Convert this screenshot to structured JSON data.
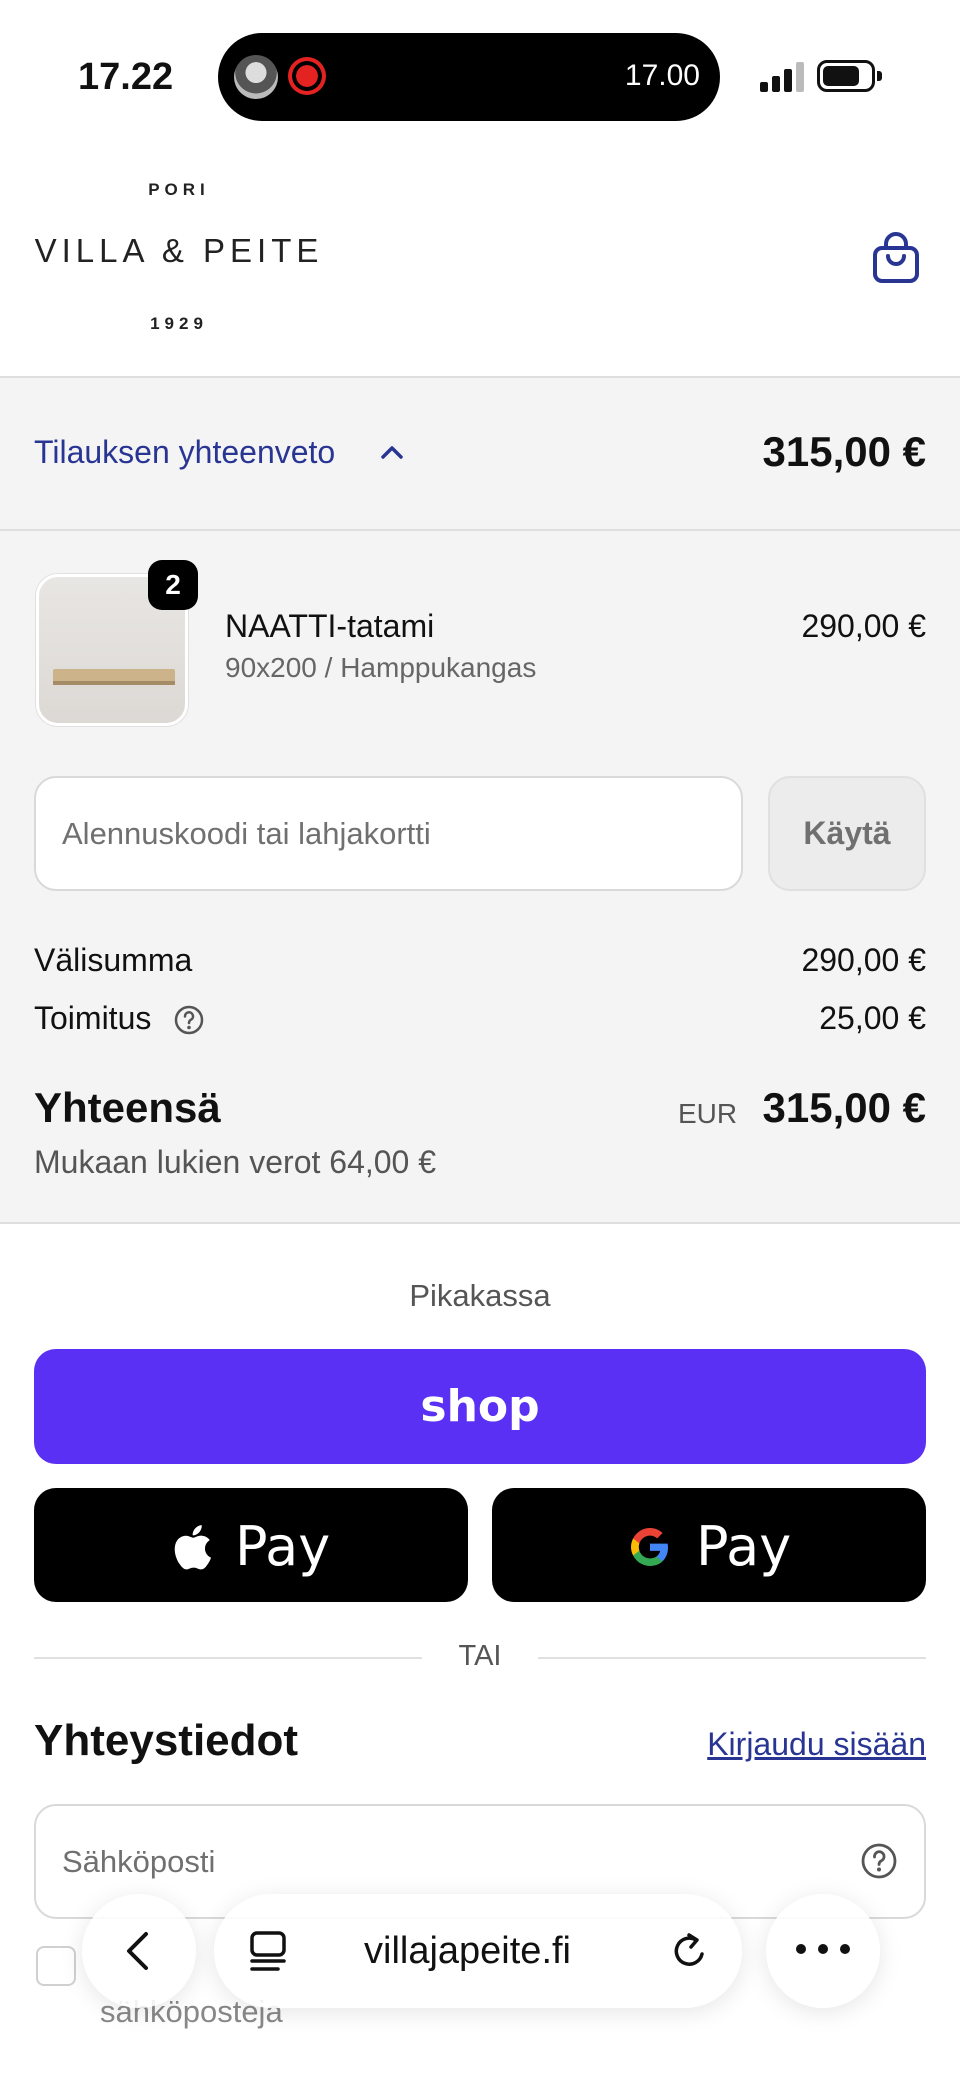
{
  "status_bar": {
    "time": "17.22",
    "live_activity_time": "17.00"
  },
  "brand": {
    "logo_top": "PORI",
    "logo_main": "VILLA & PEITE",
    "logo_bottom": "1929"
  },
  "summary": {
    "toggle_label": "Tilauksen yhteenveto",
    "total": "315,00 €",
    "item": {
      "quantity": "2",
      "name": "NAATTI-tatami",
      "variant": "90x200 / Hamppukangas",
      "price": "290,00 €"
    },
    "discount": {
      "placeholder": "Alennuskoodi tai lahjakortti",
      "apply_label": "Käytä"
    },
    "subtotal_label": "Välisumma",
    "subtotal_value": "290,00 €",
    "shipping_label": "Toimitus",
    "shipping_value": "25,00 €",
    "grand_label": "Yhteensä",
    "currency": "EUR",
    "grand_value": "315,00 €",
    "tax_note": "Mukaan lukien verot 64,00 €"
  },
  "express": {
    "label": "Pikakassa",
    "shop_label": "shop",
    "apple_pay_label": "Pay",
    "google_pay_label": "Pay",
    "divider": "TAI"
  },
  "contact": {
    "heading": "Yhteystiedot",
    "login_link": "Kirjaudu sisään",
    "email_placeholder": "Sähköposti",
    "newsletter_visible_text": "sähköposteja"
  },
  "browser": {
    "url": "villajapeite.fi"
  },
  "colors": {
    "accent_link": "#283593",
    "shop_pay": "#5a31f4",
    "summary_bg": "#f4f4f4"
  }
}
